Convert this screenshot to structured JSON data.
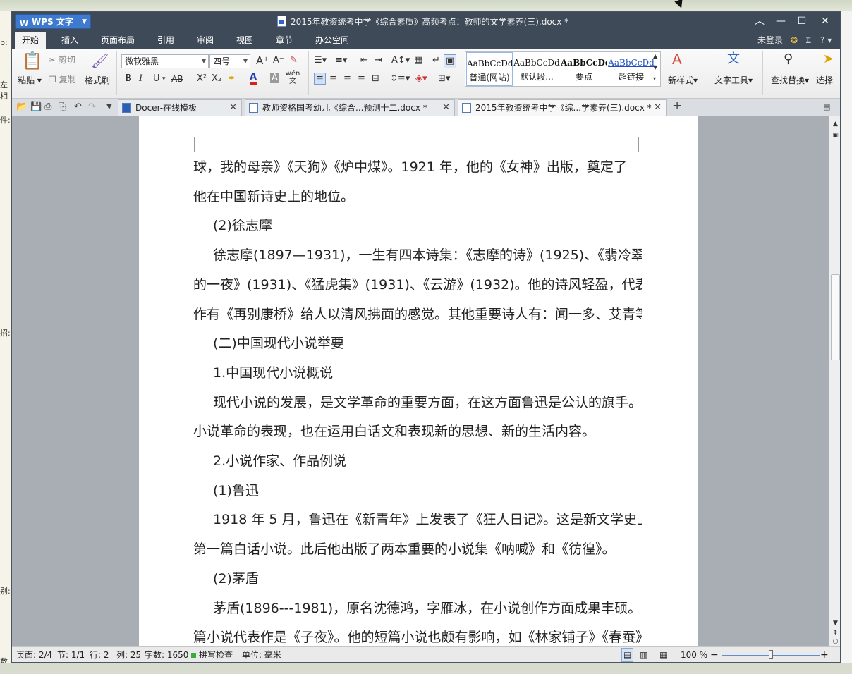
{
  "window": {
    "app_button": "WPS 文字",
    "title": "2015年教资统考中学《综合素质》高频考点：教师的文学素养(三).docx *",
    "controls": [
      "︿",
      "—",
      "☐",
      "✕"
    ]
  },
  "menu": {
    "items": [
      "开始",
      "插入",
      "页面布局",
      "引用",
      "审阅",
      "视图",
      "章节",
      "办公空间"
    ],
    "active": "开始",
    "login": "未登录",
    "help": "?"
  },
  "ribbon": {
    "paste": "粘贴",
    "cut": "剪切",
    "copy": "复制",
    "format_painter": "格式刷",
    "font_name": "微软雅黑",
    "font_size": "四号",
    "bold": "B",
    "italic": "I",
    "underline": "U",
    "strike": "AB",
    "superscript": "X²",
    "subscript": "X₂",
    "font_color": "A",
    "char_shade": "A",
    "phonetic": "wén 文",
    "styles": [
      {
        "sample": "AaBbCcDd",
        "name": "普通(网站)"
      },
      {
        "sample": "AaBbCcDd",
        "name": "默认段..."
      },
      {
        "sample": "AaBbCcDd",
        "name": "要点"
      },
      {
        "sample": "AaBbCcDd",
        "name": "超链接"
      }
    ],
    "new_style": "新样式",
    "text_tools": "文字工具",
    "find_replace": "查找替换",
    "select": "选择"
  },
  "tabs": [
    {
      "label": "Docer-在线模板",
      "active": false
    },
    {
      "label": "教师资格国考幼儿《综合...预测十二.docx *",
      "active": false
    },
    {
      "label": "2015年教资统考中学《综...学素养(三).docx *",
      "active": true
    }
  ],
  "document": {
    "lines": [
      {
        "text": "球，我的母亲》《天狗》《炉中煤》。1921 年，他的《女神》出版，奠定了",
        "indent": false
      },
      {
        "text": "他在中国新诗史上的地位。",
        "indent": false
      },
      {
        "text": "(2)徐志摩",
        "indent": true
      },
      {
        "text": "徐志摩(1897—1931)，一生有四本诗集：《志摩的诗》(1925)、《翡冷翠",
        "indent": true
      },
      {
        "text": "的一夜》(1931)、《猛虎集》(1931)、《云游》(1932)。他的诗风轻盈，代表",
        "indent": false
      },
      {
        "text": "作有《再别康桥》给人以清风拂面的感觉。其他重要诗人有：闻一多、艾青等。",
        "indent": false
      },
      {
        "text": "(二)中国现代小说举要",
        "indent": true
      },
      {
        "text": "1.中国现代小说概说",
        "indent": true
      },
      {
        "text": "现代小说的发展，是文学革命的重要方面，在这方面鲁迅是公认的旗手。",
        "indent": true
      },
      {
        "text": "小说革命的表现，也在运用白话文和表现新的思想、新的生活内容。",
        "indent": false
      },
      {
        "text": "2.小说作家、作品例说",
        "indent": true
      },
      {
        "text": "(1)鲁迅",
        "indent": true
      },
      {
        "text": "1918 年 5 月，鲁迅在《新青年》上发表了《狂人日记》。这是新文学史上",
        "indent": true
      },
      {
        "text": "第一篇白话小说。此后他出版了两本重要的小说集《呐喊》和《彷徨》。",
        "indent": false
      },
      {
        "text": "(2)茅盾",
        "indent": true
      },
      {
        "text": "茅盾(1896---1981)，原名沈德鸿，字雁冰，在小说创作方面成果丰硕。长",
        "indent": true
      },
      {
        "text": "篇小说代表作是《子夜》。他的短篇小说也颇有影响，如《林家铺子》《春蚕》",
        "indent": false
      }
    ]
  },
  "status": {
    "page": "页面: 2/4",
    "section": "节: 1/1",
    "row": "行: 2",
    "col": "列: 25",
    "words": "字数: 1650",
    "spell": "拼写检查",
    "unit": "单位: 毫米",
    "zoom": "100 %",
    "zoom_level": 0.5
  },
  "background": {
    "left_labels": [
      "p:",
      "左相",
      "件:",
      "招:",
      "别:",
      "数"
    ]
  }
}
